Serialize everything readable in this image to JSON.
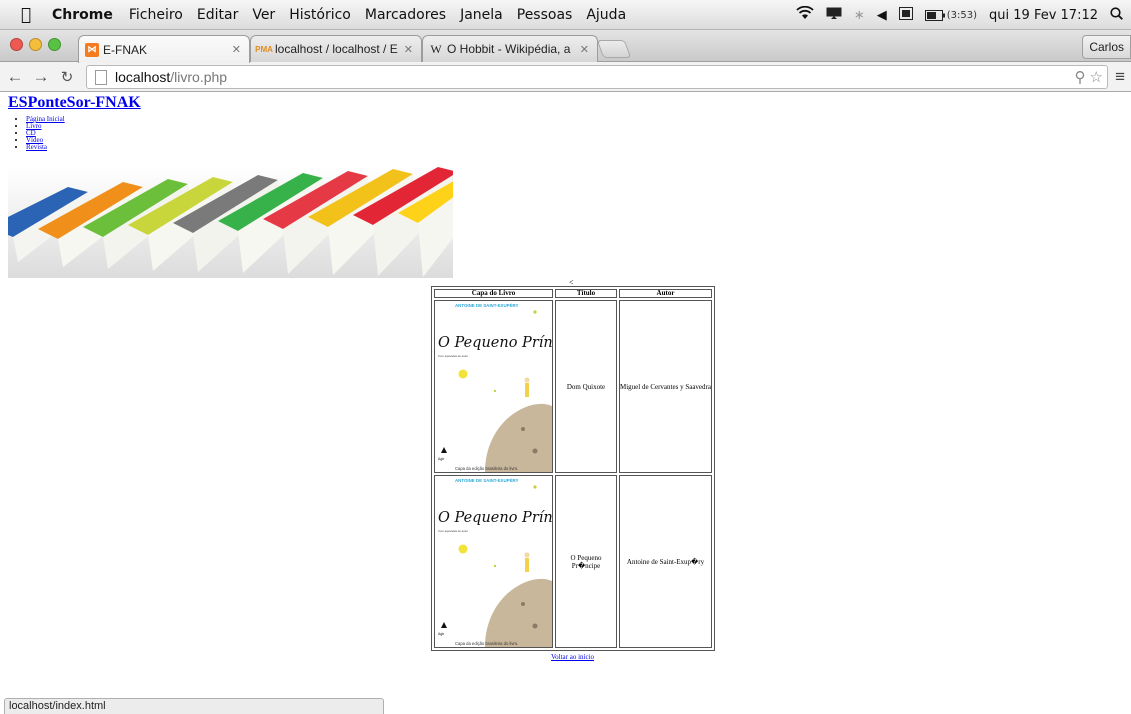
{
  "menubar": {
    "app_name": "Chrome",
    "items": [
      "Ficheiro",
      "Editar",
      "Ver",
      "Histórico",
      "Marcadores",
      "Janela",
      "Pessoas",
      "Ajuda"
    ],
    "battery": "(3:53)",
    "datetime": "qui 19 Fev  17:12"
  },
  "tabs": [
    {
      "title": "E-FNAK",
      "favicon": "xampp-icon",
      "active": true
    },
    {
      "title": "localhost / localhost / ESPo",
      "favicon": "phpmyadmin-icon",
      "active": false
    },
    {
      "title": "O Hobbit - Wikipédia, a en",
      "favicon": "wikipedia-icon",
      "active": false
    }
  ],
  "profile": "Carlos",
  "address": {
    "host": "localhost",
    "path": "/livro.php"
  },
  "page": {
    "site_title": "ESPonteSor-FNAK",
    "nav": [
      "Página Inicial",
      "Livro",
      "CD",
      "Vídeo",
      "Revista"
    ],
    "stray_char": "<",
    "table": {
      "headers": [
        "Capa do Livro",
        "Título",
        "Autor"
      ],
      "rows": [
        {
          "title": "Dom Quixote",
          "author": "Miguel de Cervantes y Saavedra"
        },
        {
          "title": "O Pequeno Pr�ncipe",
          "author": "Antoine de Saint-Exup�ry"
        }
      ]
    },
    "cover": {
      "author": "ANTOINE DE SAINT-EXUPÉRY",
      "title": "O Pequeno Príncipe",
      "subtitle": "Com aquarelas do autor",
      "publisher": "Agir",
      "caption": "Capa da edição brasileira do livro."
    },
    "back_link": "Voltar ao início"
  },
  "status_bar": "localhost/index.html",
  "colors": {
    "link": "#0000ee",
    "menubar": "#e6e6e6",
    "sky_blue": "#2ea8d8"
  }
}
